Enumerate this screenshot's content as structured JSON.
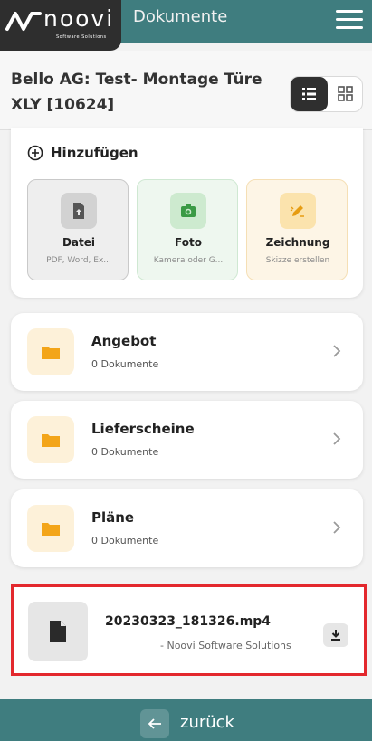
{
  "header": {
    "logo_text": "noovi",
    "logo_subtitle": "Software Solutions",
    "page_title": "Dokumente",
    "menu_icon": "hamburger-icon",
    "brand_color": "#3f7d7f"
  },
  "project": {
    "title": "Bello AG: Test- Montage Türe XLY [10624]",
    "view_modes": [
      "list",
      "grid"
    ],
    "active_view": "list"
  },
  "add_section": {
    "label": "Hinzufügen",
    "tiles": [
      {
        "title": "Datei",
        "subtitle": "PDF, Word, Ex...",
        "icon": "file-upload-icon"
      },
      {
        "title": "Foto",
        "subtitle": "Kamera oder G...",
        "icon": "camera-icon"
      },
      {
        "title": "Zeichnung",
        "subtitle": "Skizze erstellen",
        "icon": "pencil-icon"
      }
    ]
  },
  "folders": [
    {
      "name": "Angebot",
      "count": "0 Dokumente"
    },
    {
      "name": "Lieferscheine",
      "count": "0 Dokumente"
    },
    {
      "name": "Pläne",
      "count": "0 Dokumente"
    }
  ],
  "file": {
    "name": "20230323_181326.mp4",
    "author": "- Noovi Software Solutions",
    "icon": "document-icon",
    "action_icon": "download-icon"
  },
  "footer": {
    "back_label": "zurück",
    "back_icon": "arrow-left-icon"
  }
}
